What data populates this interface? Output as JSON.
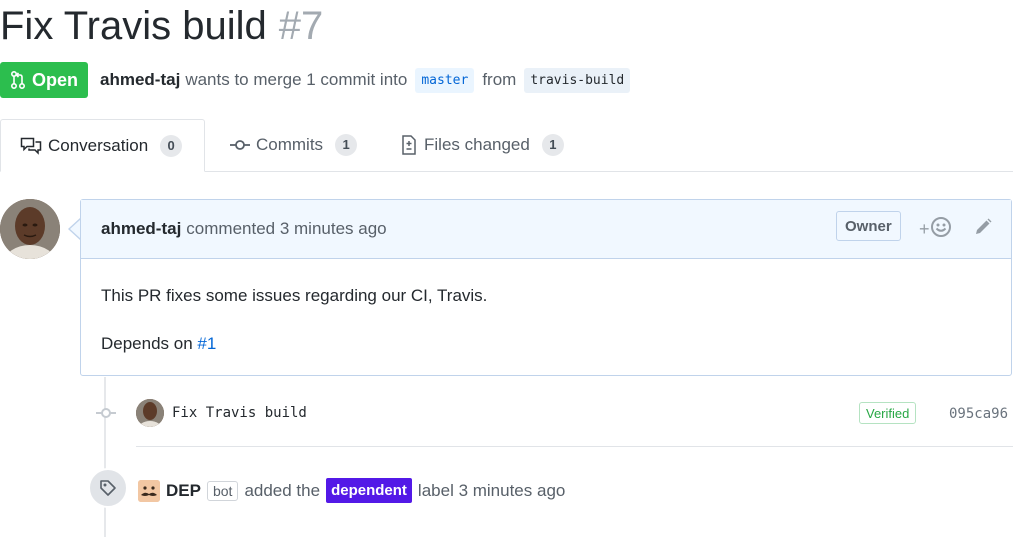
{
  "pr": {
    "title": "Fix Travis build",
    "number": "#7",
    "state": "Open",
    "author": "ahmed-taj",
    "merge_text": "wants to merge 1 commit into",
    "base_branch": "master",
    "from_text": "from",
    "head_branch": "travis-build"
  },
  "tabs": [
    {
      "label": "Conversation",
      "count": "0",
      "icon": "comment-discussion-icon",
      "selected": true
    },
    {
      "label": "Commits",
      "count": "1",
      "icon": "git-commit-icon"
    },
    {
      "label": "Files changed",
      "count": "1",
      "icon": "diff-icon"
    }
  ],
  "comment": {
    "author": "ahmed-taj",
    "action": "commented 3 minutes ago",
    "role_badge": "Owner",
    "reaction_label": "+",
    "body_line1": "This PR fixes some issues regarding our CI, Travis.",
    "body_line2_prefix": "Depends on",
    "body_link": "#1"
  },
  "commit": {
    "message": "Fix Travis build",
    "verified": "Verified",
    "sha": "095ca96"
  },
  "label_event": {
    "actor": "DEP",
    "bot_badge": "bot",
    "action_prefix": "added the",
    "label": "dependent",
    "label_color": "#5319e7",
    "action_suffix": "label 3 minutes ago"
  },
  "colors": {
    "open_green": "#2cbe4e",
    "link_blue": "#0366d6",
    "comment_header_bg": "#f1f8ff"
  }
}
